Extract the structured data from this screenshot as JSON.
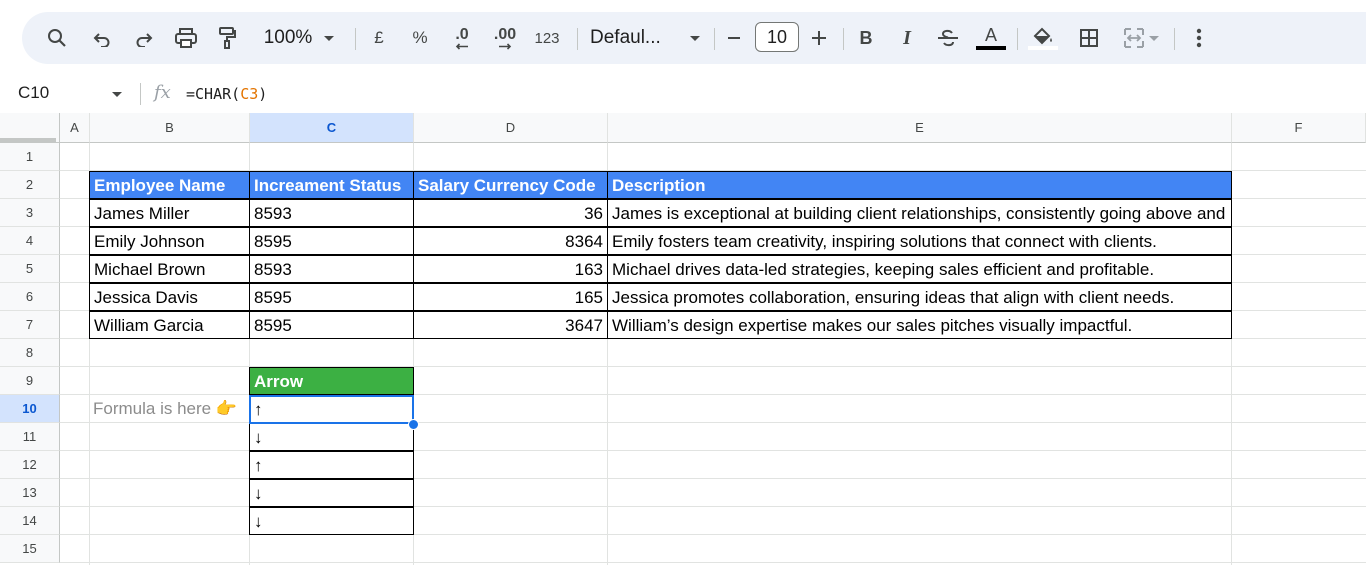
{
  "toolbar": {
    "zoom": "100%",
    "currency": "£",
    "percent": "%",
    "dec_decrease": ".0",
    "dec_increase": ".00",
    "format_123": "123",
    "font": "Defaul...",
    "font_size": "10",
    "bold": "B",
    "italic": "I",
    "text_color_letter": "A",
    "colors": {
      "accent": "#0b57d0",
      "selection": "#1a73e8"
    }
  },
  "formula_bar": {
    "name_box": "C10",
    "fx": "fx",
    "formula_prefix": "=CHAR(",
    "formula_ref": "C3",
    "formula_suffix": ")"
  },
  "columns": [
    "A",
    "B",
    "C",
    "D",
    "E",
    "F"
  ],
  "selected_column": "C",
  "rows": [
    "1",
    "2",
    "3",
    "4",
    "5",
    "6",
    "7",
    "8",
    "9",
    "10",
    "11",
    "12",
    "13",
    "14",
    "15"
  ],
  "selected_row": "10",
  "table": {
    "headers": [
      "Employee Name",
      "Increament Status",
      "Salary Currency Code",
      "Description"
    ],
    "header_color": "#4285f4",
    "rows": [
      [
        "James Miller",
        "8593",
        "36",
        "James is exceptional at building client relationships, consistently going above and beyond."
      ],
      [
        "Emily Johnson",
        "8595",
        "8364",
        "Emily fosters team creativity, inspiring solutions that connect with clients."
      ],
      [
        "Michael Brown",
        "8593",
        "163",
        "Michael drives data-led strategies, keeping sales efficient and profitable."
      ],
      [
        "Jessica Davis",
        "8595",
        "165",
        "Jessica promotes collaboration, ensuring ideas that align with client needs."
      ],
      [
        "William Garcia",
        "8595",
        "3647",
        "William’s design expertise makes our sales pitches visually impactful."
      ]
    ]
  },
  "arrow_table": {
    "header": "Arrow",
    "header_color": "#3cb043",
    "values": [
      "↑",
      "↓",
      "↑",
      "↓",
      "↓"
    ]
  },
  "note": "Formula is here 👉"
}
